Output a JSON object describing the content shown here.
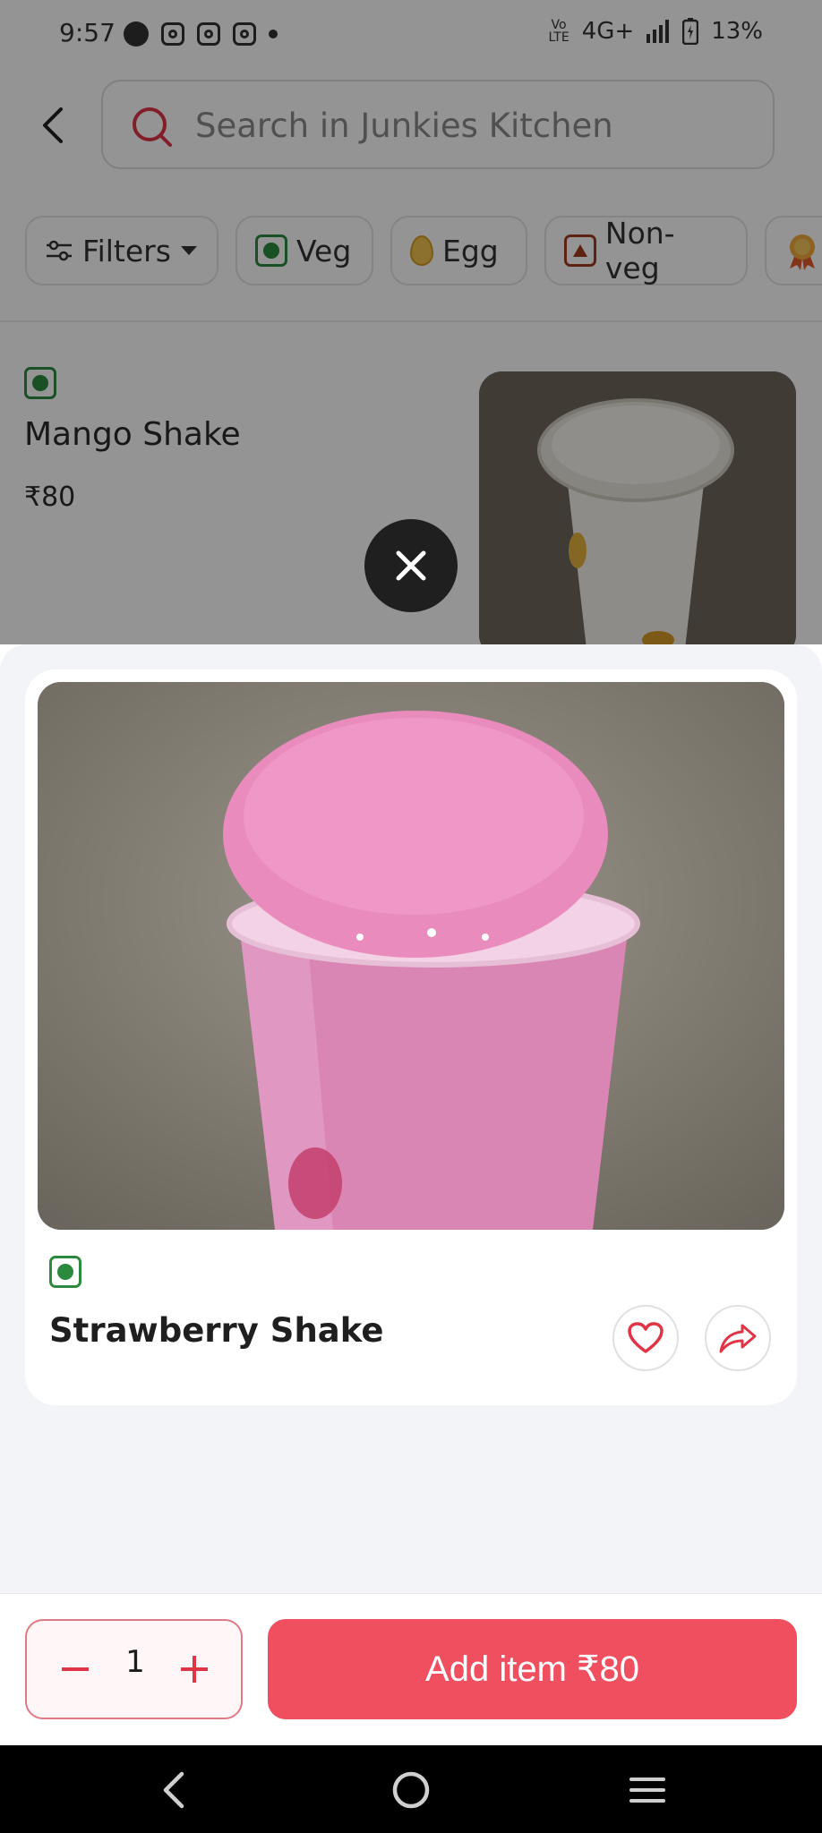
{
  "status_bar": {
    "time": "9:57",
    "network": "4G+",
    "battery": "13%"
  },
  "search": {
    "placeholder": "Search in Junkies Kitchen"
  },
  "filters": [
    {
      "label": "Filters"
    },
    {
      "label": "Veg"
    },
    {
      "label": "Egg"
    },
    {
      "label": "Non-veg"
    }
  ],
  "list_item": {
    "name": "Mango Shake",
    "price": "₹80"
  },
  "sheet": {
    "item_name": "Strawberry Shake",
    "quantity": "1",
    "add_label": "Add item ₹80"
  },
  "colors": {
    "accent": "#ef4f5f",
    "veg": "#2b8a3e",
    "nonveg": "#a23b20"
  }
}
